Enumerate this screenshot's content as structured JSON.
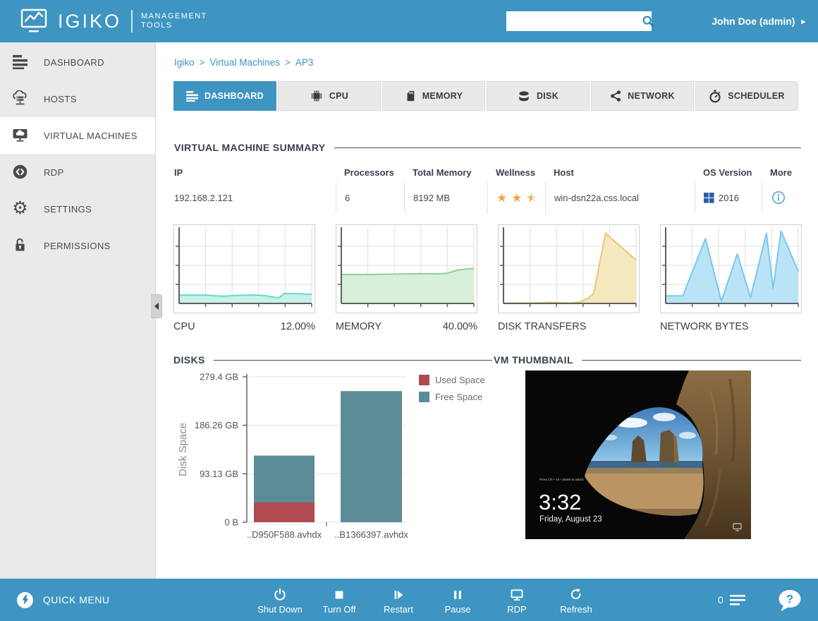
{
  "colors": {
    "primary_blue": "#3e95c1",
    "sidebar_bg": "#eaeaea",
    "star_orange": "#f2a33c",
    "windows_blue": "#2a5ca8",
    "info_blue": "#4da7d0",
    "used_space_red": "#b04a50",
    "free_space_teal": "#5d8c99"
  },
  "icons": {
    "gear": "⚙"
  },
  "header": {
    "logo_text": "IGIKO",
    "logo_subtitle_line1": "MANAGEMENT",
    "logo_subtitle_line2": "TOOLS",
    "user_label": "John Doe (admin)",
    "user_menu_arrow": "▸",
    "search_value": ""
  },
  "sidebar": {
    "items": [
      {
        "label": "DASHBOARD",
        "active": false
      },
      {
        "label": "HOSTS",
        "active": false
      },
      {
        "label": "VIRTUAL MACHINES",
        "active": true
      },
      {
        "label": "RDP",
        "active": false
      },
      {
        "label": "SETTINGS",
        "active": false
      },
      {
        "label": "PERMISSIONS",
        "active": false
      }
    ]
  },
  "breadcrumb": {
    "separator": ">",
    "items": [
      {
        "label": "Igiko"
      },
      {
        "label": "Virtual Machines"
      },
      {
        "label": "AP3"
      }
    ]
  },
  "tabs": [
    {
      "label": "DASHBOARD",
      "active": true
    },
    {
      "label": "CPU",
      "active": false
    },
    {
      "label": "MEMORY",
      "active": false
    },
    {
      "label": "DISK",
      "active": false
    },
    {
      "label": "NETWORK",
      "active": false
    },
    {
      "label": "SCHEDULER",
      "active": false
    }
  ],
  "summary": {
    "title": "VIRTUAL MACHINE SUMMARY",
    "columns": [
      "IP",
      "Processors",
      "Total Memory",
      "Wellness",
      "Host",
      "OS Version",
      "More"
    ],
    "row": {
      "ip": "192.168.2.121",
      "processors": "6",
      "total_memory": "8192 MB",
      "wellness_stars": 2.5,
      "host": "win-dsn22a.css.local",
      "os_version": "2016"
    }
  },
  "sections": {
    "disks_title": "DISKS",
    "vm_thumbnail_title": "VM THUMBNAIL"
  },
  "vm_thumbnail": {
    "time": "3:32",
    "date": "Friday, August 23",
    "unlock_hint": "Press Ctrl + Alt + Delete to unlock"
  },
  "footer": {
    "quick_menu_label": "QUICK MENU",
    "actions": [
      {
        "label": "Shut Down"
      },
      {
        "label": "Turn Off"
      },
      {
        "label": "Restart"
      },
      {
        "label": "Pause"
      },
      {
        "label": "RDP"
      },
      {
        "label": "Refresh"
      }
    ],
    "notification_count": "0",
    "help_glyph": "?"
  },
  "chart_data": [
    {
      "type": "area",
      "id": "cpu",
      "title": "CPU",
      "value_label": "12.00%",
      "ylim": [
        0,
        100
      ],
      "grid": true,
      "line_color": "#63dcc6",
      "fill_color": "#c7f1e9",
      "points": [
        [
          0,
          11
        ],
        [
          10,
          11
        ],
        [
          20,
          11
        ],
        [
          28,
          10
        ],
        [
          34,
          9.5
        ],
        [
          42,
          10.5
        ],
        [
          50,
          11
        ],
        [
          58,
          11
        ],
        [
          66,
          10
        ],
        [
          72,
          8
        ],
        [
          76,
          8
        ],
        [
          79,
          13
        ],
        [
          86,
          13
        ],
        [
          93,
          12.5
        ],
        [
          97,
          12
        ],
        [
          100,
          12.5
        ]
      ]
    },
    {
      "type": "area",
      "id": "memory",
      "title": "MEMORY",
      "value_label": "40.00%",
      "ylim": [
        0,
        100
      ],
      "grid": true,
      "line_color": "#8fcf96",
      "fill_color": "#d8efda",
      "points": [
        [
          0,
          38
        ],
        [
          20,
          38
        ],
        [
          40,
          38.5
        ],
        [
          60,
          39
        ],
        [
          74,
          39
        ],
        [
          80,
          39.5
        ],
        [
          88,
          44
        ],
        [
          100,
          46
        ]
      ]
    },
    {
      "type": "area",
      "id": "disk-transfers",
      "title": "DISK TRANSFERS",
      "value_label": "",
      "ylim": [
        0,
        100
      ],
      "grid": true,
      "line_color": "#e6c878",
      "fill_color": "#f5e8bf",
      "points": [
        [
          0,
          0.5
        ],
        [
          20,
          0.5
        ],
        [
          30,
          1
        ],
        [
          36,
          1.5
        ],
        [
          42,
          1
        ],
        [
          50,
          0.5
        ],
        [
          58,
          2
        ],
        [
          64,
          7
        ],
        [
          68,
          13
        ],
        [
          77,
          92
        ],
        [
          100,
          57
        ]
      ]
    },
    {
      "type": "area",
      "id": "network-bytes",
      "title": "NETWORK BYTES",
      "value_label": "",
      "ylim": [
        0,
        100
      ],
      "grid": true,
      "line_color": "#78c8ee",
      "fill_color": "#bbe3f6",
      "points": [
        [
          0,
          10
        ],
        [
          7,
          10
        ],
        [
          13,
          10
        ],
        [
          30,
          85
        ],
        [
          42,
          3
        ],
        [
          54,
          65
        ],
        [
          64,
          8
        ],
        [
          76,
          92
        ],
        [
          81,
          20
        ],
        [
          87,
          95
        ],
        [
          100,
          42
        ]
      ]
    },
    {
      "type": "bar",
      "id": "disks",
      "title": "DISKS",
      "ylabel": "Disk Space",
      "max_gb": 279.4,
      "yticks": [
        {
          "label": "279.4 GB",
          "gb": 279.4
        },
        {
          "label": "186.26 GB",
          "gb": 186.26
        },
        {
          "label": "93.13 GB",
          "gb": 93.13
        },
        {
          "label": "0 B",
          "gb": 0
        }
      ],
      "legend": [
        {
          "label": "Used Space",
          "color": "#b04a50"
        },
        {
          "label": "Free Space",
          "color": "#5d8c99"
        }
      ],
      "bars": [
        {
          "label": "..D950F588.avhdx",
          "used_gb": 38,
          "free_gb": 90
        },
        {
          "label": "..B1366397.avhdx",
          "used_gb": 0,
          "free_gb": 252
        }
      ]
    }
  ]
}
